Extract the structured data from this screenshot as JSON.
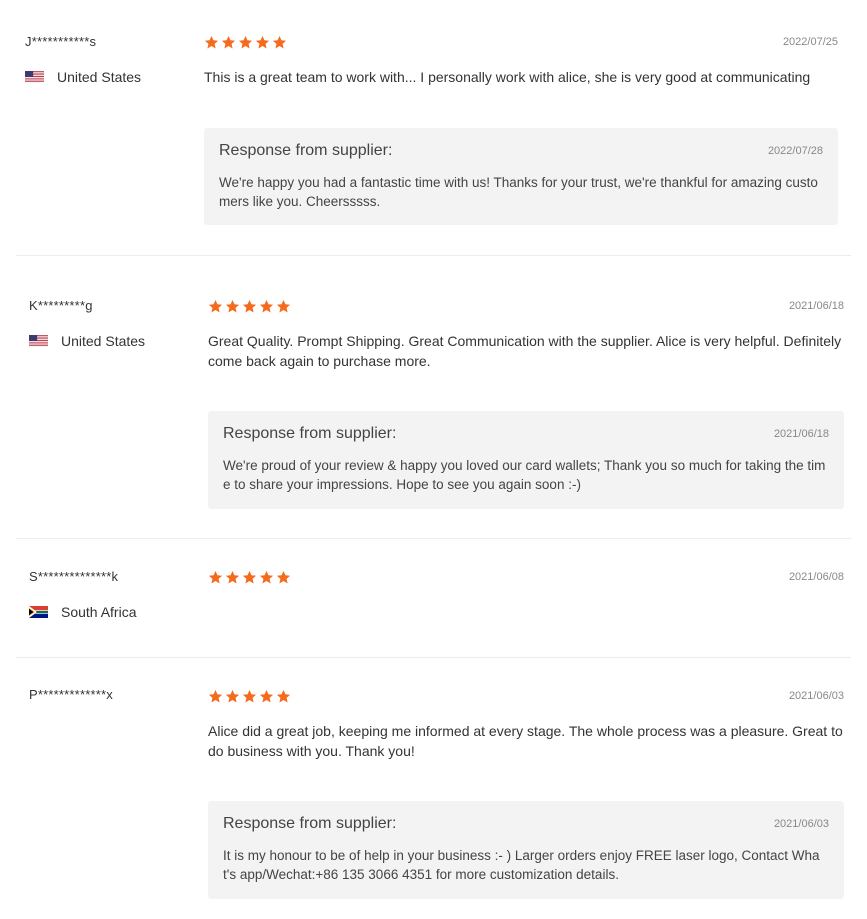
{
  "accent_color": "#f56b1e",
  "star_icon": "star-icon",
  "reviews": [
    {
      "user": "J***********s",
      "country": "United States",
      "flag": "us-flag-icon",
      "rating": 5,
      "date": "2022/07/25",
      "text": "This is a great team to work with... I personally work with alice, she is very good at communicating",
      "response": {
        "title": "Response from supplier:",
        "date": "2022/07/28",
        "text": "We're happy you had a fantastic time with us! Thanks for your trust, we're thankful for amazing customers like you. Cheersssss."
      }
    },
    {
      "user": "K*********g",
      "country": "United States",
      "flag": "us-flag-icon",
      "rating": 5,
      "date": "2021/06/18",
      "text": "Great Quality. Prompt Shipping. Great Communication with the supplier. Alice is very helpful. Definitely come back again to purchase more.",
      "response": {
        "title": "Response from supplier:",
        "date": "2021/06/18",
        "text": "We're proud of your review & happy you loved our card wallets; Thank you so much for taking the time to share your impressions. Hope to see you again soon :-)"
      }
    },
    {
      "user": "S**************k",
      "country": "South Africa",
      "flag": "za-flag-icon",
      "rating": 5,
      "date": "2021/06/08"
    },
    {
      "user": "P*************x",
      "rating": 5,
      "date": "2021/06/03",
      "text": "Alice did a great job, keeping me informed at every stage. The whole process was a pleasure. Great to do business with you. Thank you!",
      "response": {
        "title": "Response from supplier:",
        "date": "2021/06/03",
        "text": "It is my honour to be of help in your business :- )  Larger orders enjoy FREE laser logo, Contact What's app/Wechat:+86 135 3066 4351 for more customization details."
      }
    }
  ]
}
